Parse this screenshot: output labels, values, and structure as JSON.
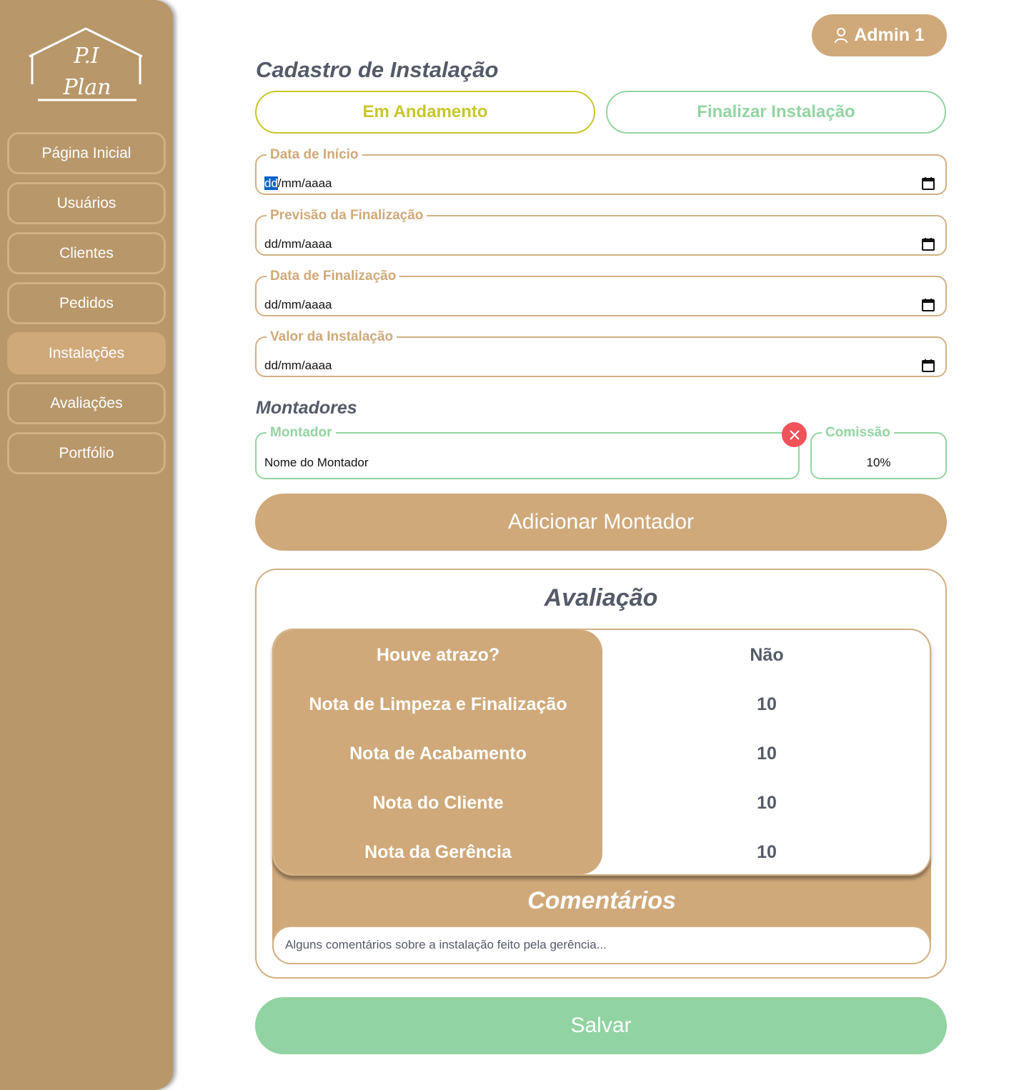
{
  "logo": {
    "line1": "P.I",
    "line2": "Plan"
  },
  "sidebar": {
    "items": [
      {
        "label": "Página Inicial"
      },
      {
        "label": "Usuários"
      },
      {
        "label": "Clientes"
      },
      {
        "label": "Pedidos"
      },
      {
        "label": "Instalações"
      },
      {
        "label": "Avaliações"
      },
      {
        "label": "Portfólio"
      }
    ],
    "active": "Instalações"
  },
  "header": {
    "user_label": "Admin 1",
    "user_icon": "user-icon"
  },
  "page": {
    "title": "Cadastro de Instalação"
  },
  "status": {
    "in_progress": "Em Andamento",
    "finish": "Finalizar Instalação"
  },
  "fields": {
    "start_date": {
      "label": "Data de Início",
      "value_selected": "dd",
      "value_rest": "/mm/aaaa"
    },
    "forecast_date": {
      "label": "Previsão da Finalização",
      "value": "dd/mm/aaaa"
    },
    "end_date": {
      "label": "Data de Finalização",
      "value": "dd/mm/aaaa"
    },
    "install_value": {
      "label": "Valor da Instalação",
      "value": "dd/mm/aaaa"
    }
  },
  "montadores": {
    "title": "Montadores",
    "montador_label": "Montador",
    "montador_value": "Nome do Montador",
    "commission_label": "Comissão",
    "commission_value": "10%",
    "add_button": "Adicionar Montador"
  },
  "evaluation": {
    "title": "Avaliação",
    "rows": [
      {
        "label": "Houve atrazo?",
        "value": "Não"
      },
      {
        "label": "Nota de Limpeza e Finalização",
        "value": "10"
      },
      {
        "label": "Nota de Acabamento",
        "value": "10"
      },
      {
        "label": "Nota do Cliente",
        "value": "10"
      },
      {
        "label": "Nota da Gerência",
        "value": "10"
      }
    ],
    "comments_title": "Comentários",
    "comments_text": "Alguns comentários sobre a instalação feito pela gerência..."
  },
  "actions": {
    "save": "Salvar"
  },
  "colors": {
    "sidebar": "#b8976a",
    "accent": "#cfa97a",
    "green": "#91d3a2",
    "yellow": "#c6c72a",
    "danger": "#f0525a",
    "title_text": "#555a68"
  }
}
